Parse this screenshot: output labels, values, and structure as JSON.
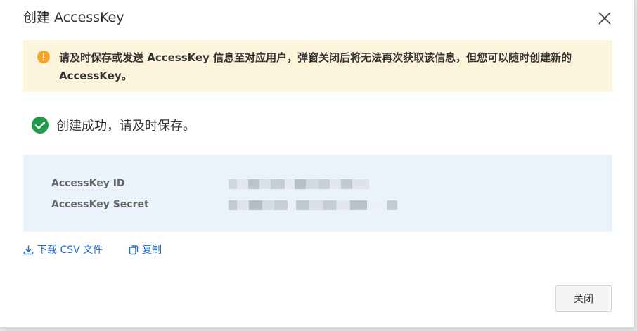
{
  "dialog": {
    "title": "创建 AccessKey",
    "close_icon": "close-icon"
  },
  "warning": {
    "icon": "warning-icon",
    "color": "#f5a623",
    "background": "#fdf4dc",
    "text": "请及时保存或发送 AccessKey 信息至对应用户，弹窗关闭后将无法再次获取该信息，但您可以随时创建新的 AccessKey。"
  },
  "success": {
    "icon": "check-circle-icon",
    "color": "#1d9a4b",
    "text": "创建成功，请及时保存。"
  },
  "keys": {
    "id_label": "AccessKey ID",
    "secret_label": "AccessKey Secret"
  },
  "actions": {
    "download_label": "下载 CSV 文件",
    "download_icon": "download-icon",
    "copy_label": "复制",
    "copy_icon": "copy-icon",
    "link_color": "#1f6fc4"
  },
  "footer": {
    "close_label": "关闭"
  }
}
